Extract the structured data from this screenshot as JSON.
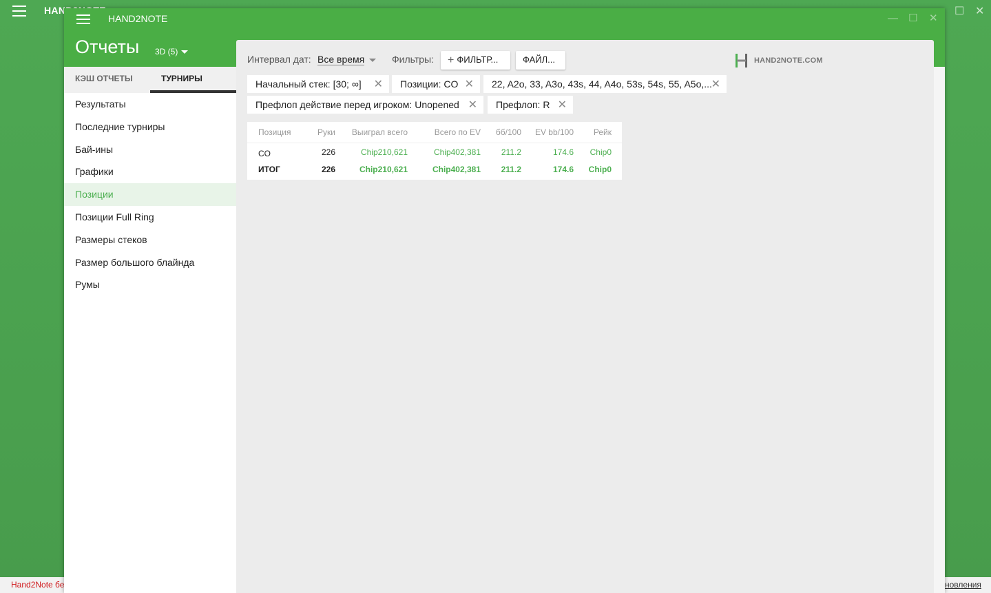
{
  "background_window": {
    "title": "HAND2NOTE",
    "status_left": "Hand2Note бе",
    "status_right": "новления"
  },
  "window": {
    "title": "HAND2NOTE",
    "controls": {
      "minimize": "—",
      "maximize": "☐",
      "close": "✕"
    }
  },
  "header": {
    "title": "Отчеты",
    "database": "3D (5)"
  },
  "sidebar": {
    "tabs": [
      {
        "label": "КЭШ ОТЧЕТЫ"
      },
      {
        "label": "ТУРНИРЫ"
      }
    ],
    "items": [
      {
        "label": "Результаты"
      },
      {
        "label": "Последние турниры"
      },
      {
        "label": "Бай-ины"
      },
      {
        "label": "Графики"
      },
      {
        "label": "Позиции"
      },
      {
        "label": "Позиции Full Ring"
      },
      {
        "label": "Размеры стеков"
      },
      {
        "label": "Размер большого блайнда"
      },
      {
        "label": "Румы"
      }
    ]
  },
  "toolbar": {
    "interval_label": "Интервал дат:",
    "interval_value": "Все время",
    "filters_label": "Фильтры:",
    "filter_button": "ФИЛЬТР...",
    "file_button": "ФАЙЛ...",
    "logo_text": "HAND2NOTE.COM"
  },
  "filters": [
    {
      "text": "Начальный стек: [30; ∞]"
    },
    {
      "text": "Позиции: CO"
    },
    {
      "text": "22, A2o, 33, A3o, 43s, 44, A4o, 53s, 54s, 55, A5o,..."
    },
    {
      "text": "Префлоп действие перед игроком: Unopened"
    },
    {
      "text": "Префлоп: R"
    }
  ],
  "table": {
    "headers": [
      "Позиция",
      "Руки",
      "Выиграл всего",
      "Всего по EV",
      "бб/100",
      "EV bb/100",
      "Рейк"
    ],
    "rows": [
      {
        "position": "CO",
        "hands": "226",
        "won": "Chip210,621",
        "ev_total": "Chip402,381",
        "bb100": "211.2",
        "ev_bb100": "174.6",
        "rake": "Chip0"
      }
    ],
    "total": {
      "position": "ИТОГ",
      "hands": "226",
      "won": "Chip210,621",
      "ev_total": "Chip402,381",
      "bb100": "211.2",
      "ev_bb100": "174.6",
      "rake": "Chip0"
    }
  },
  "colors": {
    "brand_green": "#4aae45",
    "value_green": "#4caf50"
  }
}
